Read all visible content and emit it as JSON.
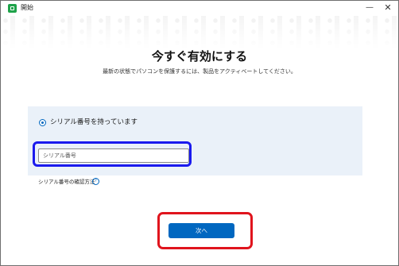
{
  "window": {
    "title": "開始",
    "minimize_glyph": "—",
    "close_glyph": "✕",
    "app_icon": "app-logo-icon"
  },
  "header": {
    "heading": "今すぐ有効にする",
    "subheading": "最新の状態でパソコンを保護するには、製品をアクティベートしてください。"
  },
  "activation": {
    "option_label": "シリアル番号を持っています",
    "option_selected": true,
    "serial_placeholder": "シリアル番号",
    "serial_value": "",
    "help_link": "シリアル番号の確認方法",
    "help_icon_glyph": "?"
  },
  "footer": {
    "next_label": "次へ"
  },
  "colors": {
    "accent": "#0067c0",
    "panel_bg": "#eaf1f9",
    "highlight_blue": "#1a1aee",
    "highlight_red": "#e0141d",
    "app_icon": "#1fa34a"
  }
}
